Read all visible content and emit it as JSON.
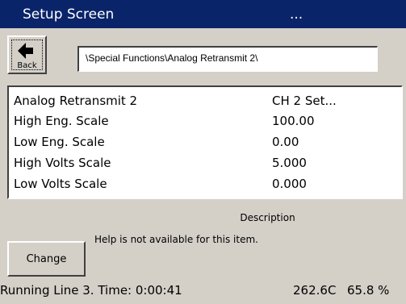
{
  "titlebar": {
    "title": "Setup Screen",
    "right_text": "..."
  },
  "back_button": {
    "label": "Back",
    "icon": "left-arrow-icon"
  },
  "path": {
    "value": "\\Special Functions\\Analog Retransmit 2\\"
  },
  "settings": [
    {
      "name": "Analog Retransmit 2",
      "value": "CH 2 Set..."
    },
    {
      "name": "High Eng. Scale",
      "value": "100.00"
    },
    {
      "name": "Low Eng. Scale",
      "value": "0.00"
    },
    {
      "name": "High Volts Scale",
      "value": "5.000"
    },
    {
      "name": "Low Volts Scale",
      "value": "0.000"
    }
  ],
  "description": {
    "label": "Description",
    "text": "Help is not available for this item."
  },
  "change_button": {
    "label": "Change"
  },
  "status": {
    "text": "Running Line 3.  Time: 0:00:41",
    "temperature": "262.6C",
    "percent": "65.8 %"
  },
  "colors": {
    "titlebar": "#0a246a",
    "background": "#d4d0c8",
    "list_background": "#ffffff"
  }
}
